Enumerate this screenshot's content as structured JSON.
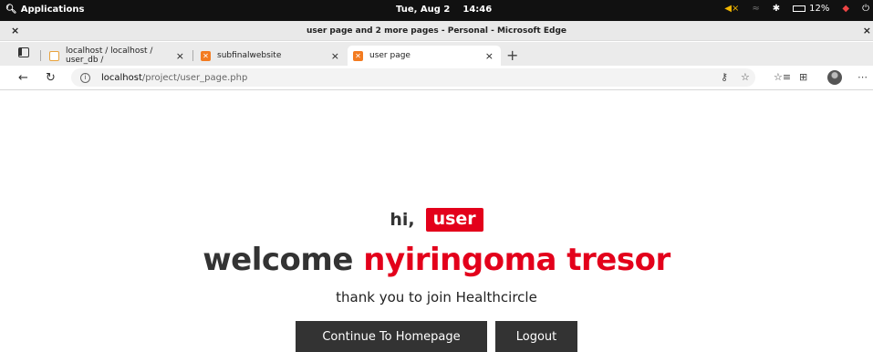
{
  "os": {
    "applications": "Applications",
    "date": "Tue, Aug 2",
    "time": "14:46",
    "battery": "12%",
    "icons": [
      "search-icon",
      "mute-icon",
      "wifi-icon",
      "bluetooth-icon",
      "battery-icon",
      "notification-icon",
      "power-icon"
    ]
  },
  "window": {
    "title": "user page and 2 more pages - Personal - Microsoft Edge"
  },
  "tabs": [
    {
      "label": "localhost / localhost / user_db /",
      "favicon": "phpmyadmin-icon"
    },
    {
      "label": "subfinalwebsite",
      "favicon": "xampp-icon"
    },
    {
      "label": "user page",
      "favicon": "xampp-icon",
      "active": true
    }
  ],
  "address": {
    "host": "localhost",
    "path": "/project/user_page.php"
  },
  "page": {
    "hi": "hi,",
    "user_badge": "user",
    "welcome": "welcome",
    "name": "nyiringoma tresor",
    "thanks": "thank you to join Healthcircle",
    "home_button": "Continue To Homepage",
    "logout_button": "Logout",
    "accent_color": "#e3001b",
    "button_color": "#333333"
  }
}
